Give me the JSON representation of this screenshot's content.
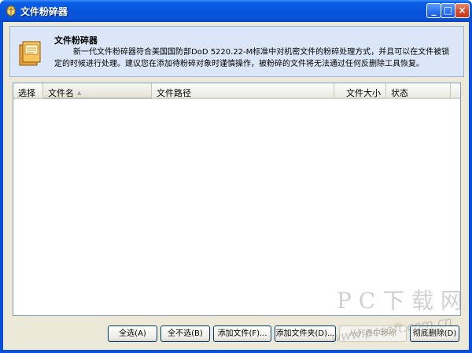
{
  "window": {
    "title": "文件粉碎器",
    "controls": {
      "minimize": "_",
      "maximize": "□",
      "close": "×"
    }
  },
  "header": {
    "title": "文件粉碎器",
    "description": "新一代文件粉碎器符合美国国防部DoD 5220.22-M标准中对机密文件的粉碎处理方式，并且可以在文件被锁定的时候进行处理。建议您在添加待粉碎对象时谨慎操作，被粉碎的文件将无法通过任何反删除工具恢复。",
    "icon": "shredder-icon"
  },
  "list": {
    "columns": [
      {
        "label": "选择"
      },
      {
        "label": "文件名",
        "sorted": "ascending"
      },
      {
        "label": "文件路径"
      },
      {
        "label": "文件大小"
      },
      {
        "label": "状态"
      },
      {
        "label": ""
      }
    ],
    "rows": []
  },
  "buttons": {
    "select_all": "全选(A)",
    "select_none": "全不选(B)",
    "add_file": "添加文件(F)...",
    "add_folder": "添加文件夹(D)...",
    "remove_from_list": "从列表中移除",
    "shred": "彻底删除(D)"
  },
  "watermark": {
    "line1": "P C 下 载 网",
    "line2": "www.pcsoft.com.cn"
  },
  "colors": {
    "titlebar": "#0553dc",
    "client_bg": "#ece9d8",
    "header_bg": "#dbe7f8",
    "list_border": "#7f9db9"
  }
}
